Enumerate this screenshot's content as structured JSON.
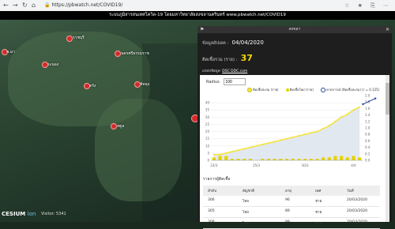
{
  "browser": {
    "url": "https://pbwatch.net/COVID19/"
  },
  "site": {
    "title": "ระบบภูมิสารสนเทศโควิด-19 โดยมหาวิทยาลัยสงขลานครินทร์ www.pbwatch.net/COVID19"
  },
  "map": {
    "markers": [
      {
        "label": "ราชบุรี"
      },
      {
        "label": "พ.มา"
      },
      {
        "label": "นครศรีธรรมราช"
      },
      {
        "label": "ระนอง"
      },
      {
        "label": "ตรัง"
      },
      {
        "label": "พัทลุง"
      },
      {
        "label": "สตูล"
      }
    ],
    "logo": {
      "brand": "CESIUM",
      "suffix": "ion"
    },
    "visitor_text": "Visitor: 5341"
  },
  "panel": {
    "title": "สงขลา",
    "date_label": "ข้อมูลอัปเดต :",
    "date_value": "04/04/2020",
    "total_label": "ติดเชื้อรวม (ราย) :",
    "total_value": "37",
    "source_label": "แหล่งข้อมูล:",
    "source_link": "DSC DDC.com",
    "radius_label": "Radius",
    "radius_value": "100"
  },
  "chart_data": {
    "type": "bar",
    "x_tick_labels": [
      "23/3",
      "25/3",
      "30/3",
      "4/4"
    ],
    "legend": [
      {
        "name": "ติดเชื้อสะสม (ราย)",
        "color": "#f5e642"
      },
      {
        "name": "ติดเชื้อใหม่ (ราย)",
        "color": "#e6d200"
      },
      {
        "name": "คาดการณ์ (ติดเชื้อสะสม) (r = 0.125)",
        "color": "#1f3f9f"
      }
    ],
    "left_axis": {
      "min": 0,
      "max": 40,
      "ticks": [
        0,
        5,
        10,
        15,
        20,
        25,
        30,
        35,
        40
      ]
    },
    "right_axis": {
      "min": 0,
      "max": 2.0,
      "ticks": [
        0,
        0.2,
        0.4,
        0.6,
        0.8,
        1.0,
        1.2,
        1.4,
        1.6,
        1.8,
        2.0
      ]
    },
    "series": [
      {
        "name": "ติดเชื้อสะสม (ราย)",
        "type": "area",
        "values": [
          4,
          4,
          5,
          6,
          7,
          8,
          9,
          10,
          11,
          12,
          13,
          14,
          15,
          16,
          17,
          18,
          19,
          20,
          22,
          24,
          27,
          30,
          32,
          35,
          37
        ]
      },
      {
        "name": "ติดเชื้อใหม่ (ราย)",
        "type": "bar",
        "values": [
          2,
          3,
          3,
          1,
          1,
          1,
          1,
          0,
          1,
          1,
          1,
          1,
          1,
          1,
          1,
          1,
          1,
          1,
          2,
          2,
          3,
          3,
          2,
          3,
          2
        ]
      },
      {
        "name": "คาดการณ์ (ติดเชื้อสะสม) (r = 0.125)",
        "type": "line",
        "x_index": [
          23,
          24
        ],
        "values": [
          39,
          43
        ]
      }
    ],
    "ylim": [
      0,
      45
    ]
  },
  "table": {
    "title": "รายการผู้ติดเชื้อ",
    "headers": [
      "ลำดับ",
      "สัญชาติ",
      "อายุ",
      "เพศ",
      "วันที่"
    ],
    "rows": [
      [
        "306",
        "ไทย",
        "96",
        "ชาย",
        "20/03/2020"
      ],
      [
        "305",
        "ไทย",
        "89",
        "ชาย",
        "20/03/2020"
      ],
      [
        "308",
        "ไทย",
        "89",
        "ชาย",
        "20/03/2020"
      ]
    ]
  }
}
